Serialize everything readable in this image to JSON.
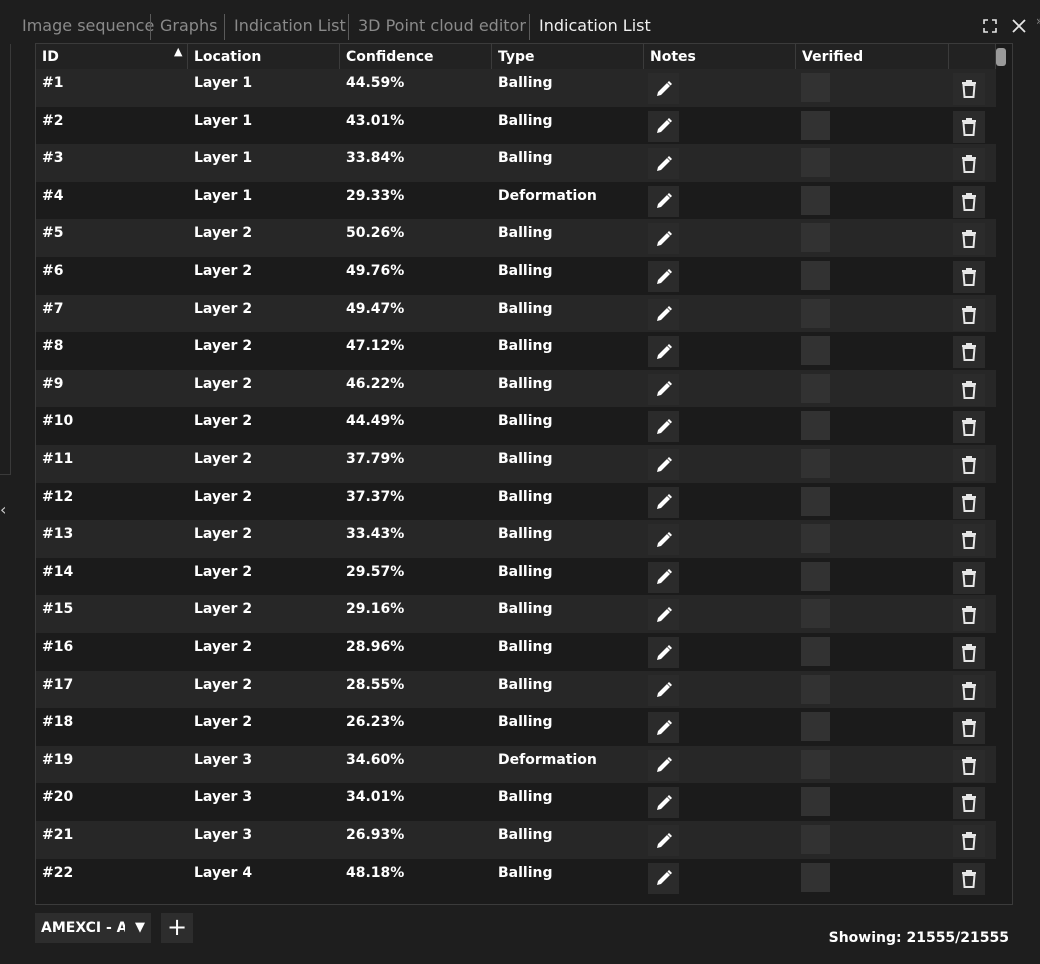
{
  "tabs": [
    {
      "label": "Image sequence",
      "active": false
    },
    {
      "label": "Graphs",
      "active": false
    },
    {
      "label": "Indication List",
      "active": false
    },
    {
      "label": "3D Point cloud editor",
      "active": false
    },
    {
      "label": "Indication List",
      "active": true
    }
  ],
  "icons": {
    "maximize": "maximize-icon",
    "close": "close-icon",
    "sort": "sort-asc-icon",
    "notes": "pencil-icon",
    "delete": "trash-icon",
    "dropdown": "chevron-down-icon",
    "add": "plus-icon",
    "collapse": "chevron-left-icon"
  },
  "table": {
    "columns": [
      "ID",
      "Location",
      "Confidence",
      "Type",
      "Notes",
      "Verified"
    ],
    "sort": {
      "column": "ID",
      "direction": "asc"
    },
    "rows": [
      {
        "id": "#1",
        "location": "Layer 1",
        "confidence": "44.59%",
        "type": "Balling"
      },
      {
        "id": "#2",
        "location": "Layer 1",
        "confidence": "43.01%",
        "type": "Balling"
      },
      {
        "id": "#3",
        "location": "Layer 1",
        "confidence": "33.84%",
        "type": "Balling"
      },
      {
        "id": "#4",
        "location": "Layer 1",
        "confidence": "29.33%",
        "type": "Deformation"
      },
      {
        "id": "#5",
        "location": "Layer 2",
        "confidence": "50.26%",
        "type": "Balling"
      },
      {
        "id": "#6",
        "location": "Layer 2",
        "confidence": "49.76%",
        "type": "Balling"
      },
      {
        "id": "#7",
        "location": "Layer 2",
        "confidence": "49.47%",
        "type": "Balling"
      },
      {
        "id": "#8",
        "location": "Layer 2",
        "confidence": "47.12%",
        "type": "Balling"
      },
      {
        "id": "#9",
        "location": "Layer 2",
        "confidence": "46.22%",
        "type": "Balling"
      },
      {
        "id": "#10",
        "location": "Layer 2",
        "confidence": "44.49%",
        "type": "Balling"
      },
      {
        "id": "#11",
        "location": "Layer 2",
        "confidence": "37.79%",
        "type": "Balling"
      },
      {
        "id": "#12",
        "location": "Layer 2",
        "confidence": "37.37%",
        "type": "Balling"
      },
      {
        "id": "#13",
        "location": "Layer 2",
        "confidence": "33.43%",
        "type": "Balling"
      },
      {
        "id": "#14",
        "location": "Layer 2",
        "confidence": "29.57%",
        "type": "Balling"
      },
      {
        "id": "#15",
        "location": "Layer 2",
        "confidence": "29.16%",
        "type": "Balling"
      },
      {
        "id": "#16",
        "location": "Layer 2",
        "confidence": "28.96%",
        "type": "Balling"
      },
      {
        "id": "#17",
        "location": "Layer 2",
        "confidence": "28.55%",
        "type": "Balling"
      },
      {
        "id": "#18",
        "location": "Layer 2",
        "confidence": "26.23%",
        "type": "Balling"
      },
      {
        "id": "#19",
        "location": "Layer 3",
        "confidence": "34.60%",
        "type": "Deformation"
      },
      {
        "id": "#20",
        "location": "Layer 3",
        "confidence": "34.01%",
        "type": "Balling"
      },
      {
        "id": "#21",
        "location": "Layer 3",
        "confidence": "26.93%",
        "type": "Balling"
      },
      {
        "id": "#22",
        "location": "Layer 4",
        "confidence": "48.18%",
        "type": "Balling"
      }
    ]
  },
  "footer": {
    "filter_select": "AMEXCI - Al",
    "status": "Showing: 21555/21555"
  },
  "colors": {
    "background": "#1e1e1e",
    "row_even": "#272727",
    "row_odd": "#1b1b1b",
    "text": "#ffffff",
    "muted_text": "#8a8a8a"
  }
}
